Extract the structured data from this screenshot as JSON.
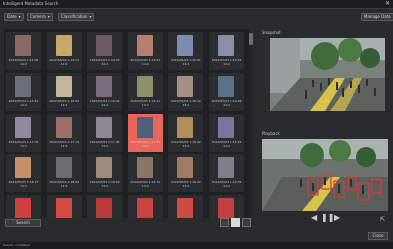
{
  "window": {
    "title": "Intelligent Metadata Search",
    "close_glyph": "✕"
  },
  "toolbar": {
    "buttons": [
      {
        "label": "Date"
      },
      {
        "label": "Camera"
      },
      {
        "label": "Classification"
      }
    ],
    "manage_label": "Manage Data"
  },
  "results": {
    "selected_index": 15,
    "thumbnails": [
      {
        "date": "2022/05/03 1:14:05",
        "sec": "14:2",
        "color": "#8b6a66"
      },
      {
        "date": "2022/05/03 1:14:22",
        "sec": "14:2",
        "color": "#c9a867"
      },
      {
        "date": "2022/05/03 1:14:33",
        "sec": "14:2",
        "color": "#6c5a66"
      },
      {
        "date": "2022/05/03 1:14:54",
        "sec": "14:2",
        "color": "#b87f6d"
      },
      {
        "date": "2022/05/03 1:15:01",
        "sec": "14:2",
        "color": "#7d8db1"
      },
      {
        "date": "2022/05/03 1:15:22",
        "sec": "14:2",
        "color": "#8a8fa8"
      },
      {
        "date": "2022/05/03 1:15:41",
        "sec": "14:2",
        "color": "#6a6f7b"
      },
      {
        "date": "2022/05/03 1:15:54",
        "sec": "14:2",
        "color": "#c2b79a"
      },
      {
        "date": "2022/05/03 1:16:02",
        "sec": "14:2",
        "color": "#7b6c80"
      },
      {
        "date": "2022/05/03 1:16:11",
        "sec": "14:2",
        "color": "#8e8f6a"
      },
      {
        "date": "2022/05/03 1:16:32",
        "sec": "14:2",
        "color": "#a58e86"
      },
      {
        "date": "2022/05/03 1:16:49",
        "sec": "14:2",
        "color": "#5f6f8e"
      },
      {
        "date": "2022/05/03 1:17:03",
        "sec": "14:2",
        "color": "#8f8aa1"
      },
      {
        "date": "2022/05/03 1:17:19",
        "sec": "14:2",
        "color": "#9c6f68"
      },
      {
        "date": "2022/05/03 1:17:35",
        "sec": "14:2",
        "color": "#8d8a93"
      },
      {
        "date": "2022/05/03 1:17:44",
        "sec": "14:2",
        "color": "#4f5f7a"
      },
      {
        "date": "2022/05/03 1:18:02",
        "sec": "14:2",
        "color": "#b28e5d"
      },
      {
        "date": "2022/05/03 1:18:15",
        "sec": "14:2",
        "color": "#7b74a0"
      },
      {
        "date": "2022/05/03 1:18:27",
        "sec": "14:2",
        "color": "#c58f6b"
      },
      {
        "date": "2022/05/03 1:18:44",
        "sec": "14:2",
        "color": "#6e6a74"
      },
      {
        "date": "2022/05/03 1:18:59",
        "sec": "14:2",
        "color": "#9b8c7c"
      },
      {
        "date": "2022/05/03 1:19:10",
        "sec": "14:2",
        "color": "#8a7668"
      },
      {
        "date": "2022/05/03 1:19:22",
        "sec": "14:2",
        "color": "#a17c60"
      },
      {
        "date": "2022/05/03 1:19:35",
        "sec": "14:2",
        "color": "#7d7f8c"
      },
      {
        "date": "",
        "sec": "",
        "color": "#c9403c"
      },
      {
        "date": "",
        "sec": "",
        "color": "#d64942"
      },
      {
        "date": "",
        "sec": "",
        "color": "#b83b3a"
      },
      {
        "date": "",
        "sec": "",
        "color": "#c94440"
      },
      {
        "date": "",
        "sec": "",
        "color": "#d04a44"
      },
      {
        "date": "",
        "sec": "",
        "color": "#c3423f"
      }
    ],
    "search_label": "Search"
  },
  "snapshot": {
    "label": "Snapshot"
  },
  "playback": {
    "label": "Playback"
  },
  "controls": {
    "prev": "◀",
    "pause": "❚❚",
    "next": "▶",
    "export_glyph": "⇱",
    "close_label": "Close"
  },
  "status": {
    "text": "Search completed"
  }
}
